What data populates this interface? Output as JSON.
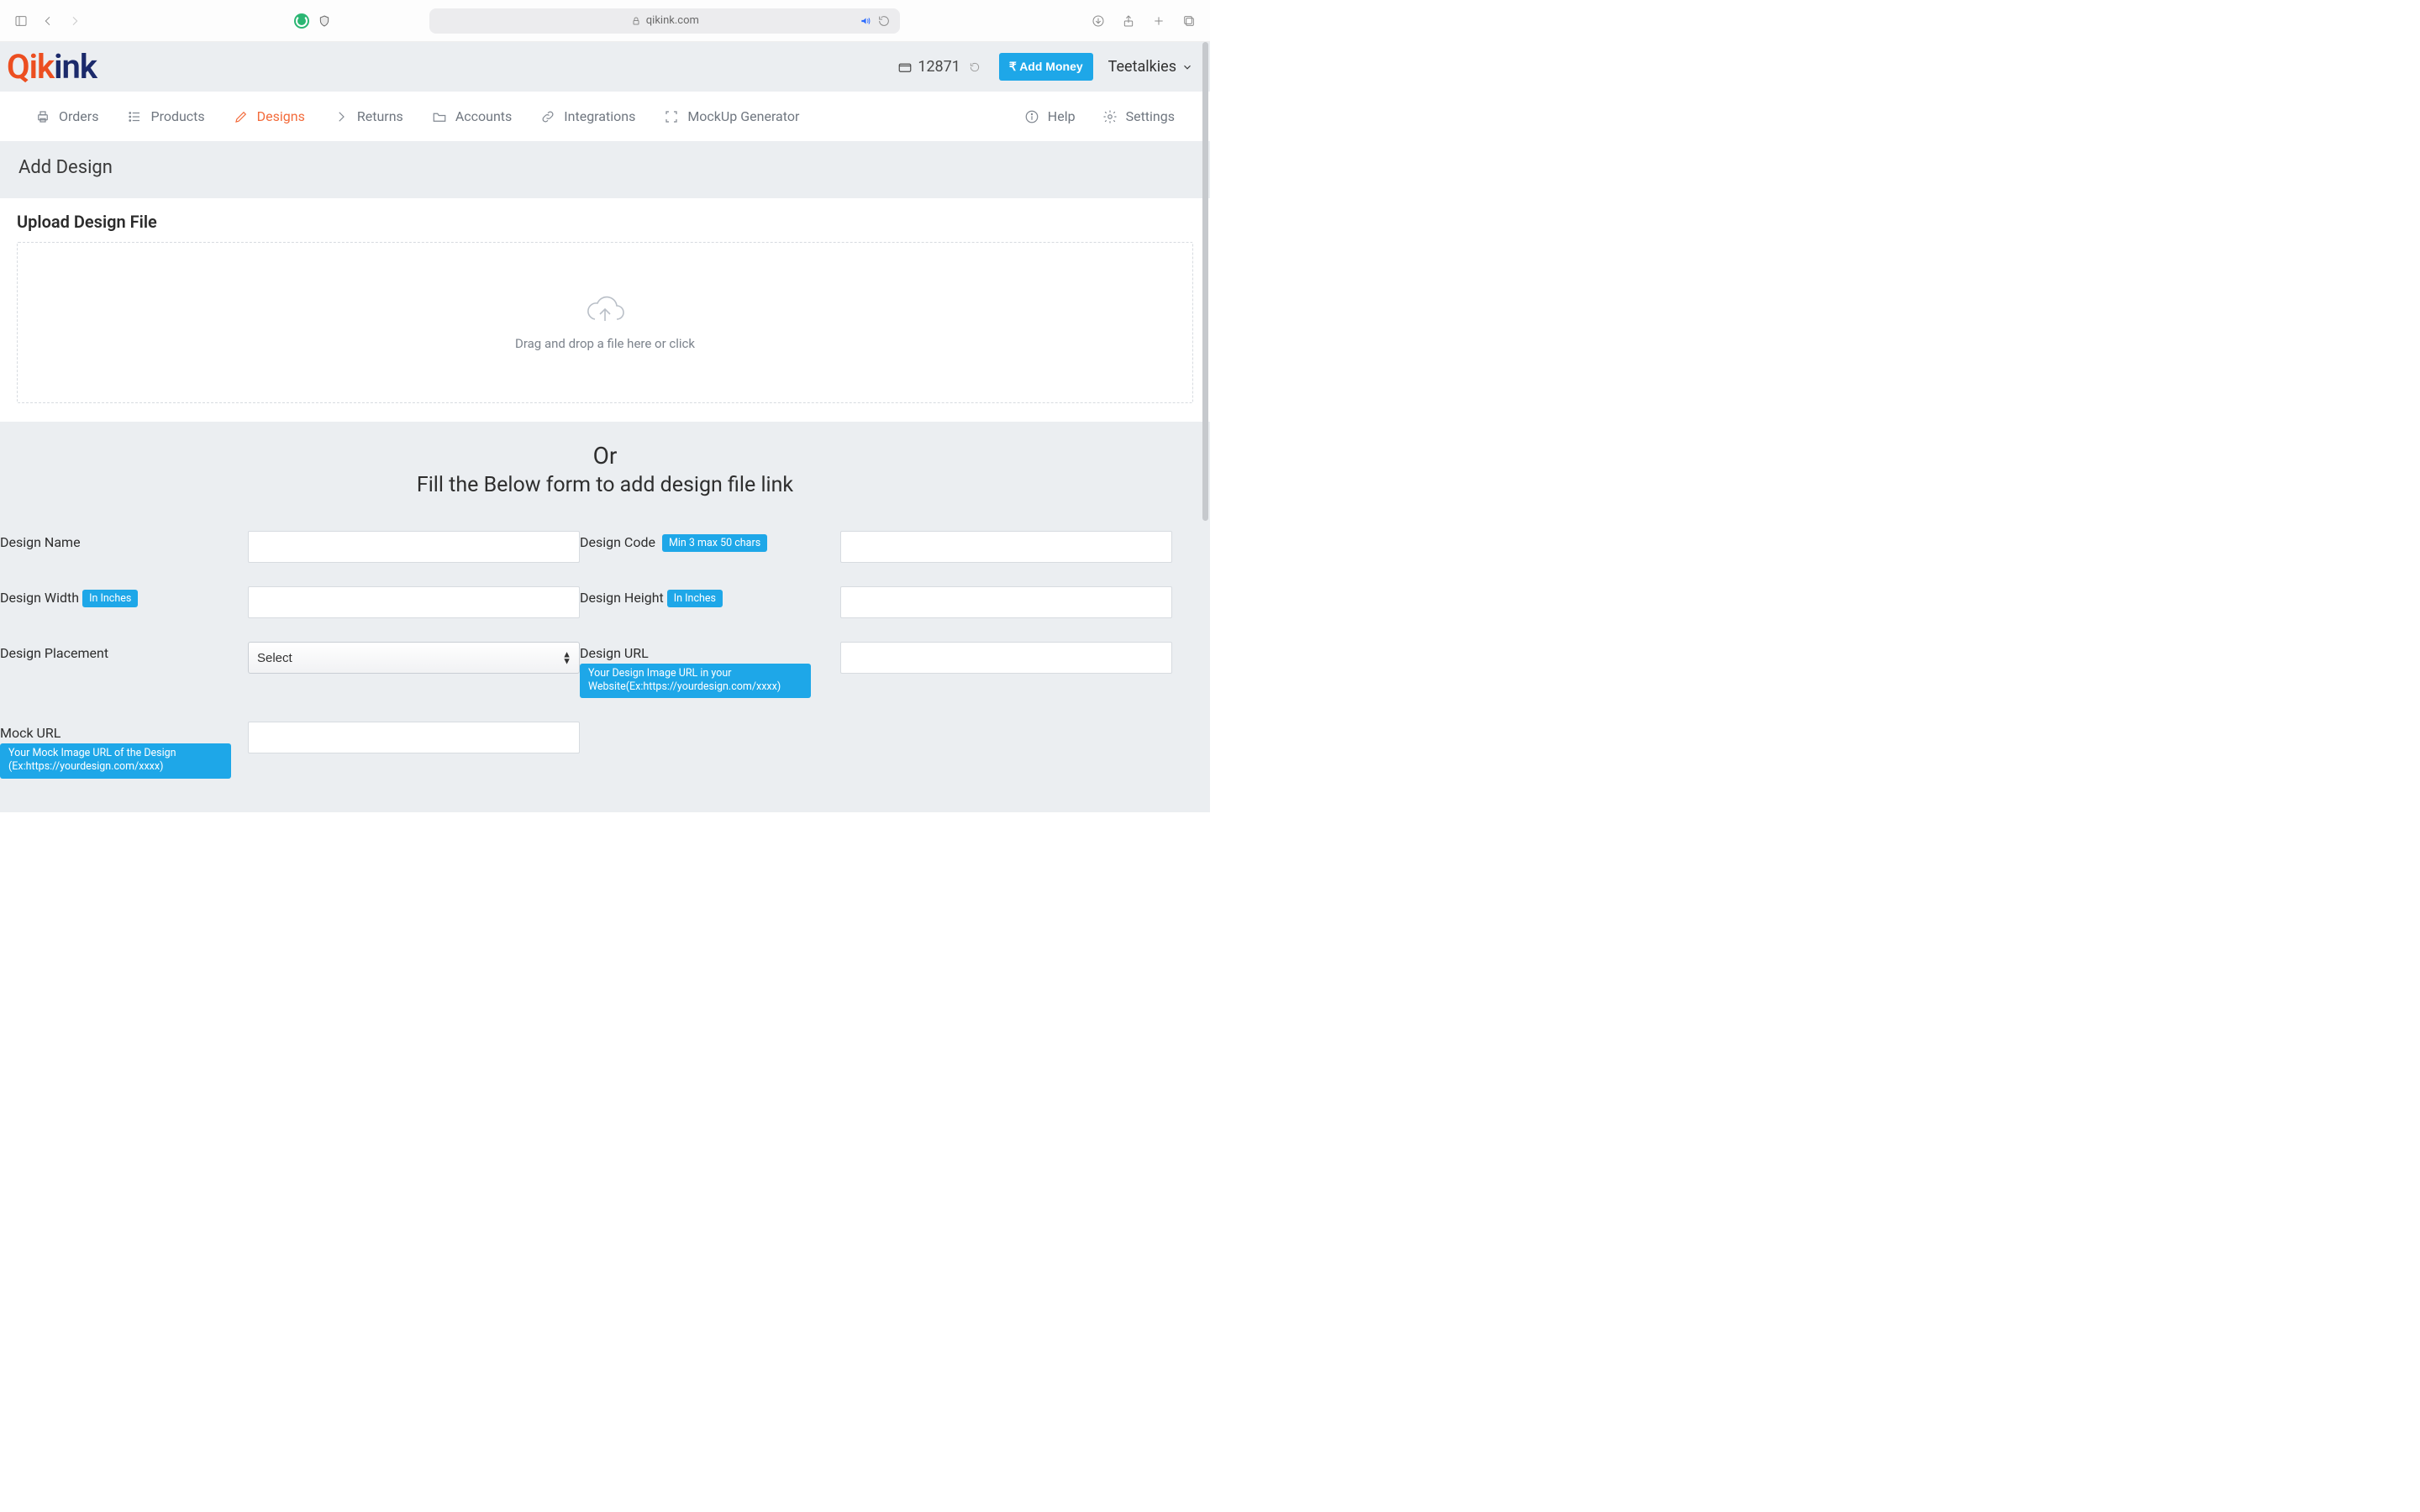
{
  "browser": {
    "url_host": "qikink.com"
  },
  "header": {
    "logo_prefix": "Qik",
    "logo_suffix": "ink",
    "wallet_balance": "12871",
    "add_money_label": "₹ Add Money",
    "user_name": "Teetalkies"
  },
  "nav": {
    "items": [
      {
        "label": "Orders"
      },
      {
        "label": "Products"
      },
      {
        "label": "Designs",
        "active": true
      },
      {
        "label": "Returns"
      },
      {
        "label": "Accounts"
      },
      {
        "label": "Integrations"
      },
      {
        "label": "MockUp Generator"
      }
    ],
    "help_label": "Help",
    "settings_label": "Settings"
  },
  "page": {
    "section_title": "Add Design",
    "upload_title": "Upload Design File",
    "dropzone_text": "Drag and drop a file here or click",
    "or_text": "Or",
    "or_subtitle": "Fill the Below form to add design file link"
  },
  "form": {
    "design_name_label": "Design Name",
    "design_code_label": "Design Code",
    "design_code_badge": "Min 3 max 50 chars",
    "design_width_label": "Design Width",
    "design_height_label": "Design Height",
    "dim_badge": "In Inches",
    "placement_label": "Design Placement",
    "placement_selected": "Select",
    "design_url_label": "Design URL",
    "design_url_hint": "Your Design Image URL in your Website(Ex:https://yourdesign.com/xxxx)",
    "mock_url_label": "Mock URL",
    "mock_url_hint": "Your Mock Image URL of the Design (Ex:https://yourdesign.com/xxxx)"
  }
}
